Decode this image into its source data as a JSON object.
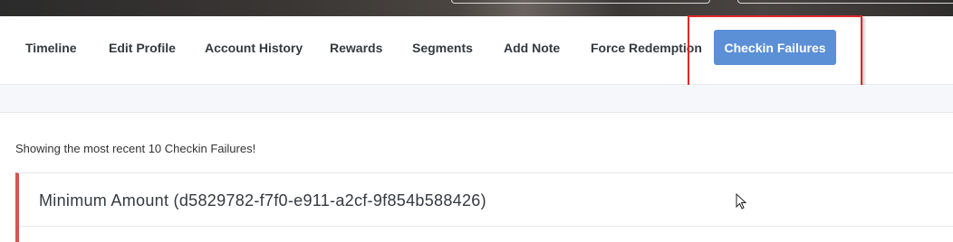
{
  "nav": {
    "items": [
      {
        "label": "Timeline"
      },
      {
        "label": "Edit Profile"
      },
      {
        "label": "Account History"
      },
      {
        "label": "Rewards"
      },
      {
        "label": "Segments"
      },
      {
        "label": "Add Note"
      },
      {
        "label": "Force Redemption"
      }
    ],
    "active_label": "Checkin Failures"
  },
  "main": {
    "info_text": "Showing the most recent 10 Checkin Failures!",
    "cards": [
      {
        "title": "Minimum Amount (d5829782-f7f0-e911-a2cf-9f854b588426)"
      }
    ]
  },
  "colors": {
    "active_button": "#5b8fd6",
    "card_accent": "#d9534f",
    "highlight_box": "#e0262a"
  },
  "icons": {
    "cursor": "mouse-pointer-icon"
  }
}
